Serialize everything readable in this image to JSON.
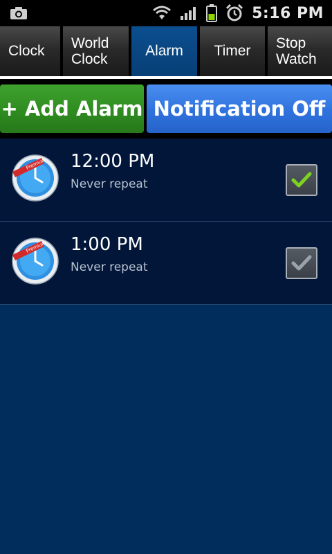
{
  "status_bar": {
    "time": "5:16 PM",
    "icons": [
      "camera-icon",
      "wifi-icon",
      "signal-icon",
      "battery-icon",
      "alarm-icon"
    ]
  },
  "tabs": [
    {
      "label": "Clock",
      "active": false
    },
    {
      "label": "World Clock",
      "line1": "World",
      "line2": "Clock",
      "active": false
    },
    {
      "label": "Alarm",
      "active": true
    },
    {
      "label": "Timer",
      "active": false
    },
    {
      "label": "Stop Watch",
      "line1": "Stop",
      "line2": "Watch",
      "active": false
    }
  ],
  "actions": {
    "add_alarm_label": "+ Add Alarm",
    "notification_label": "Notification Off"
  },
  "alarms": [
    {
      "time": "12:00 PM",
      "repeat": "Never repeat",
      "enabled": true,
      "badge": "Premium"
    },
    {
      "time": "1:00 PM",
      "repeat": "Never repeat",
      "enabled": false,
      "badge": "Premium"
    }
  ],
  "colors": {
    "background": "#012d5c",
    "list_row": "#02163a",
    "add_button": "#2d8a1f",
    "notification_button": "#2f72de",
    "active_tab": "#083f76",
    "check_on": "#7ed321",
    "check_off": "#9aa2ab"
  }
}
